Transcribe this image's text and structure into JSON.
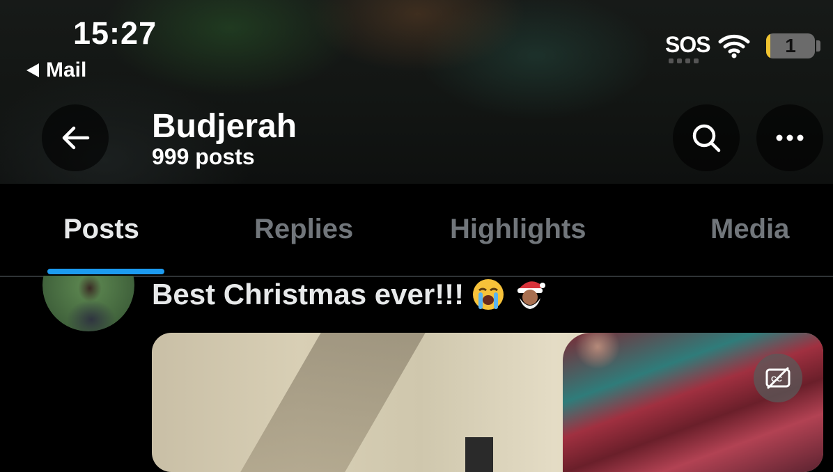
{
  "status_bar": {
    "time": "15:27",
    "back_app": "Mail",
    "sos_label": "SOS",
    "battery_level": "1"
  },
  "profile": {
    "name": "Budjerah",
    "post_count": "999 posts"
  },
  "tabs": [
    {
      "label": "Posts",
      "active": true
    },
    {
      "label": "Replies",
      "active": false
    },
    {
      "label": "Highlights",
      "active": false
    },
    {
      "label": "Media",
      "active": false
    }
  ],
  "post": {
    "text": "Best Christmas ever!!!",
    "emojis": [
      "loudly-crying-face",
      "santa-claus"
    ]
  },
  "colors": {
    "accent": "#1d9bf0",
    "tab_inactive": "#71767b",
    "tab_active": "#e7e9ea"
  }
}
